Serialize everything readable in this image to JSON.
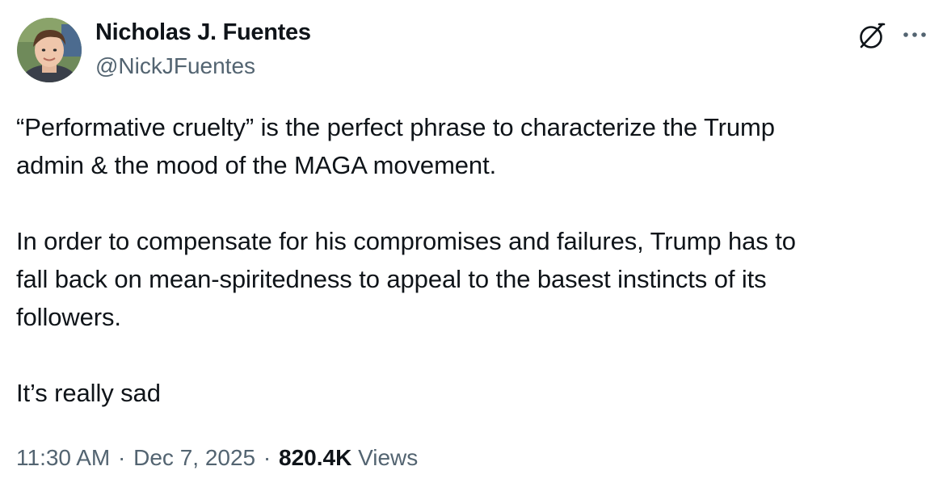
{
  "author": {
    "display_name": "Nicholas J. Fuentes",
    "handle": "@NickJFuentes"
  },
  "icons": {
    "avatar": "profile-photo",
    "grok": "grok-icon",
    "more": "more-horizontal-icon"
  },
  "tweet": {
    "paragraphs": [
      "“Performative cruelty” is the perfect phrase to characterize the Trump\nadmin & the mood of the MAGA movement.",
      "In order to compensate for his compromises and failures, Trump has to\nfall back on mean-spiritedness to appeal to the basest instincts of its\nfollowers.",
      "It’s really sad"
    ]
  },
  "meta": {
    "time": "11:30 AM",
    "separator": "·",
    "date": "Dec 7, 2025",
    "views_count": "820.4K",
    "views_label": "Views"
  },
  "colors": {
    "text_primary": "#0f1419",
    "text_secondary": "#536471",
    "background": "#ffffff"
  }
}
